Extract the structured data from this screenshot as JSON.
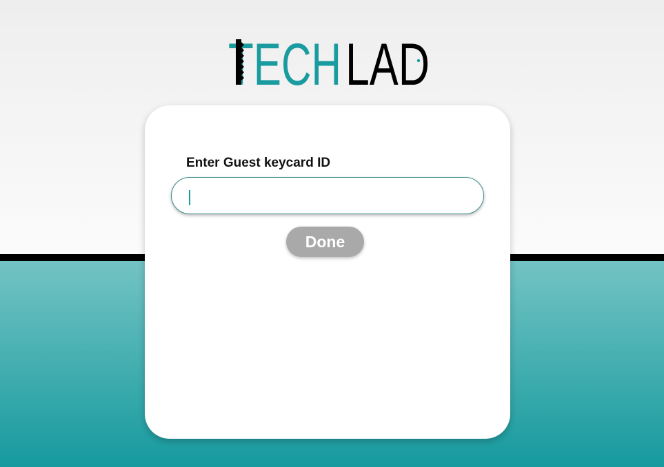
{
  "brand": {
    "logo_part1": "TECH",
    "logo_part2": "LAD",
    "color_teal": "#1a9ba0",
    "color_black": "#000000",
    "icons": [
      "keycard-notch-icon",
      "door-handle-icon"
    ]
  },
  "form": {
    "label": "Enter Guest keycard ID",
    "input_value": "",
    "done_label": "Done"
  },
  "colors": {
    "background_top": "#f2f2f2",
    "divider": "#000000",
    "background_bottom_start": "#73c3c3",
    "background_bottom_end": "#169a9e",
    "button_disabled": "#a9a9a9"
  }
}
